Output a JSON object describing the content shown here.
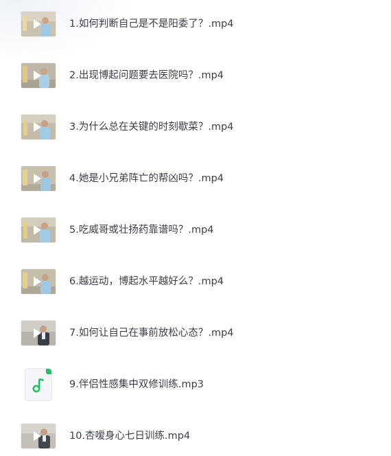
{
  "files": [
    {
      "name": "1.如何判断自己是不是阳委了？.mp4",
      "type": "video",
      "icon": "video-thumbnail-icon"
    },
    {
      "name": "2.出现博起问题要去医院吗？.mp4",
      "type": "video",
      "icon": "video-thumbnail-icon"
    },
    {
      "name": "3.为什么总在关键的时刻歇菜？.mp4",
      "type": "video",
      "icon": "video-thumbnail-icon"
    },
    {
      "name": "4.她是小兄弟阵亡的帮凶吗？.mp4",
      "type": "video",
      "icon": "video-thumbnail-icon"
    },
    {
      "name": "5.吃威哥或壮扬药靠谱吗？.mp4",
      "type": "video",
      "icon": "video-thumbnail-icon"
    },
    {
      "name": "6.越运动，博起水平越好么？.mp4",
      "type": "video",
      "icon": "video-thumbnail-icon"
    },
    {
      "name": "7.如何让自己在事前放松心态？.mp4",
      "type": "video",
      "icon": "video-thumbnail-icon"
    },
    {
      "name": "9.伴侣性感集中双修训练.mp3",
      "type": "audio",
      "icon": "music-note-icon"
    },
    {
      "name": "10.杏嗳身心七日训练.mp4",
      "type": "video",
      "icon": "video-thumbnail-icon"
    }
  ],
  "colors": {
    "text": "#3a3f47",
    "audio_accent": "#2dbb6a",
    "thumb_wall": "#b9b7ae",
    "thumb_shirt": "#9fc9e4",
    "play_icon": "#ffffff"
  }
}
